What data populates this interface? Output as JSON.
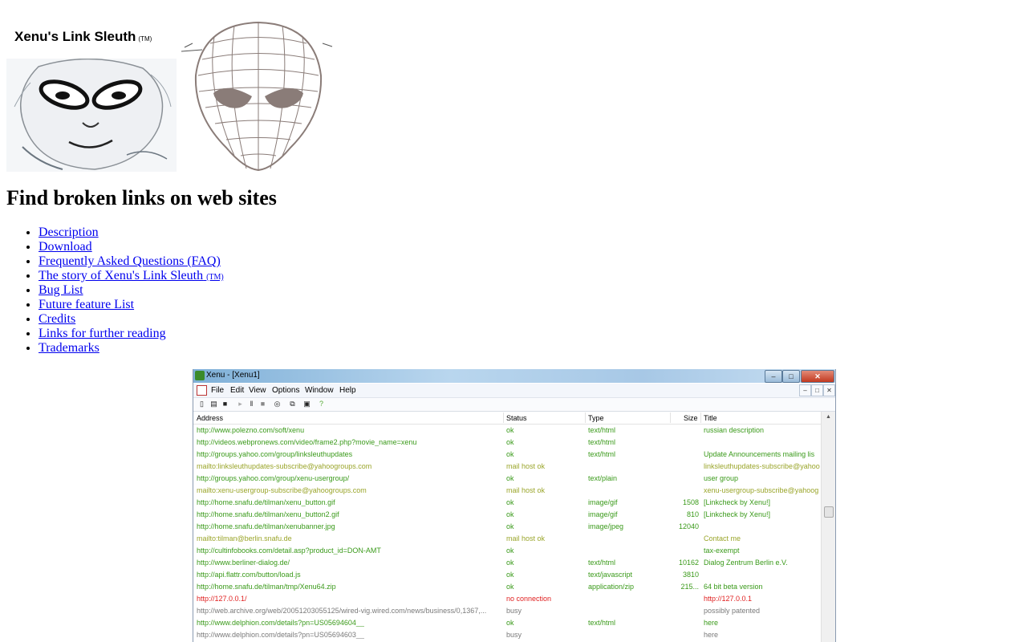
{
  "logo": {
    "title": "Xenu's Link Sleuth",
    "tm": "(TM)"
  },
  "headline": "Find broken links on web sites",
  "nav_links": [
    {
      "label": "Description"
    },
    {
      "label": "Download"
    },
    {
      "label": "Frequently Asked Questions (FAQ)"
    },
    {
      "label": "The story of Xenu's Link Sleuth",
      "suffix": "(TM)"
    },
    {
      "label": "Bug List"
    },
    {
      "label": "Future feature List"
    },
    {
      "label": "Credits"
    },
    {
      "label": "Links for further reading"
    },
    {
      "label": "Trademarks"
    }
  ],
  "screenshot": {
    "window_title": "Xenu - [Xenu1]",
    "menu": [
      "File",
      "Edit",
      "View",
      "Options",
      "Window",
      "Help"
    ],
    "columns": {
      "address": "Address",
      "status": "Status",
      "type": "Type",
      "size": "Size",
      "title": "Title"
    },
    "colors": {
      "ok": "#3a9a1a",
      "mail": "#9aa52a",
      "error": "#e02020",
      "busy": "#7a7a7a"
    },
    "rows": [
      {
        "address": "http://www.polezno.com/soft/xenu",
        "status": "ok",
        "type": "text/html",
        "size": "",
        "title": "russian description",
        "kind": "ok"
      },
      {
        "address": "http://videos.webpronews.com/video/frame2.php?movie_name=xenu",
        "status": "ok",
        "type": "text/html",
        "size": "",
        "title": "",
        "kind": "ok"
      },
      {
        "address": "http://groups.yahoo.com/group/linksleuthupdates",
        "status": "ok",
        "type": "text/html",
        "size": "",
        "title": "Update Announcements mailing lis",
        "kind": "ok"
      },
      {
        "address": "mailto:linksleuthupdates-subscribe@yahoogroups.com",
        "status": "mail host ok",
        "type": "",
        "size": "",
        "title": "linksleuthupdates-subscribe@yahoo",
        "kind": "mail"
      },
      {
        "address": "http://groups.yahoo.com/group/xenu-usergroup/",
        "status": "ok",
        "type": "text/plain",
        "size": "",
        "title": "user group",
        "kind": "ok"
      },
      {
        "address": "mailto:xenu-usergroup-subscribe@yahoogroups.com",
        "status": "mail host ok",
        "type": "",
        "size": "",
        "title": "xenu-usergroup-subscribe@yahoog",
        "kind": "mail"
      },
      {
        "address": "http://home.snafu.de/tilman/xenu_button.gif",
        "status": "ok",
        "type": "image/gif",
        "size": "1508",
        "title": "[Linkcheck by Xenu!]",
        "kind": "ok"
      },
      {
        "address": "http://home.snafu.de/tilman/xenu_button2.gif",
        "status": "ok",
        "type": "image/gif",
        "size": "810",
        "title": "[Linkcheck by Xenu!]",
        "kind": "ok"
      },
      {
        "address": "http://home.snafu.de/tilman/xenubanner.jpg",
        "status": "ok",
        "type": "image/jpeg",
        "size": "12040",
        "title": "",
        "kind": "ok"
      },
      {
        "address": "mailto:tilman@berlin.snafu.de",
        "status": "mail host ok",
        "type": "",
        "size": "",
        "title": "Contact me",
        "kind": "mail"
      },
      {
        "address": "http://cultinfobooks.com/detail.asp?product_id=DON-AMT",
        "status": "ok",
        "type": "",
        "size": "",
        "title": "tax-exempt",
        "kind": "ok"
      },
      {
        "address": "http://www.berliner-dialog.de/",
        "status": "ok",
        "type": "text/html",
        "size": "10162",
        "title": "Dialog Zentrum Berlin e.V.",
        "kind": "ok"
      },
      {
        "address": "http://api.flattr.com/button/load.js",
        "status": "ok",
        "type": "text/javascript",
        "size": "3810",
        "title": "",
        "kind": "ok"
      },
      {
        "address": "http://home.snafu.de/tilman/tmp/Xenu64.zip",
        "status": "ok",
        "type": "application/zip",
        "size": "215...",
        "title": "64 bit beta version",
        "kind": "ok"
      },
      {
        "address": "http://127.0.0.1/",
        "status": "no connection",
        "type": "",
        "size": "",
        "title": "http://127.0.0.1",
        "kind": "error"
      },
      {
        "address": "http://web.archive.org/web/20051203055125/wired-vig.wired.com/news/business/0,1367,...",
        "status": "busy",
        "type": "",
        "size": "",
        "title": "possibly patented",
        "kind": "busy"
      },
      {
        "address": "http://www.delphion.com/details?pn=US05694604__",
        "status": "ok",
        "type": "text/html",
        "size": "",
        "title": "here",
        "kind": "ok"
      },
      {
        "address": "http://www.delphion.com/details?pn=US05694603__",
        "status": "busy",
        "type": "",
        "size": "",
        "title": "here",
        "kind": "busy"
      }
    ]
  }
}
